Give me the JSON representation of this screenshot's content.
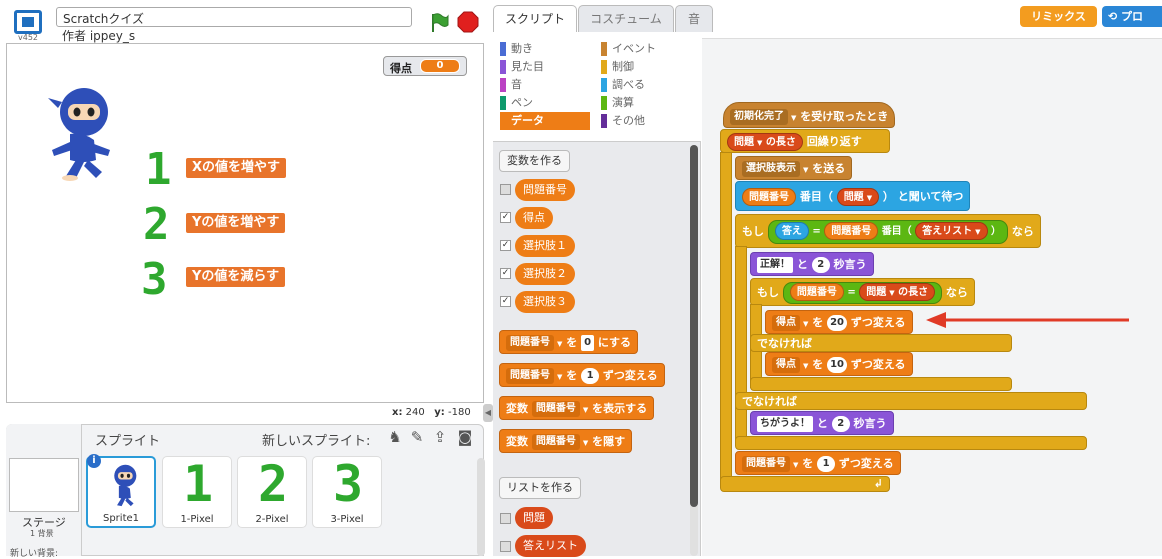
{
  "header": {
    "version": "v452",
    "project_title": "Scratchクイズ",
    "author": "作者 ippey_s"
  },
  "stage": {
    "score_label": "得点",
    "score_value": "0",
    "rows": [
      {
        "num": "1",
        "label": "Xの値を増やす"
      },
      {
        "num": "2",
        "label": "Yの値を増やす"
      },
      {
        "num": "3",
        "label": "Yの値を減らす"
      }
    ],
    "coords_x_label": "x:",
    "coords_x": "240",
    "coords_y_label": "y:",
    "coords_y": "-180"
  },
  "sprites": {
    "header": "スプライト",
    "new_sprite": "新しいスプライト:",
    "stage_name": "ステージ",
    "stage_count": "1 背景",
    "new_bg": "新しい背景:",
    "items": [
      {
        "name": "Sprite1",
        "glyph": ""
      },
      {
        "name": "1-Pixel",
        "glyph": "1"
      },
      {
        "name": "2-Pixel",
        "glyph": "2"
      },
      {
        "name": "3-Pixel",
        "glyph": "3"
      }
    ]
  },
  "tabs": [
    "スクリプト",
    "コスチューム",
    "音"
  ],
  "topbar": {
    "remix": "リミックス",
    "pro": "プロ"
  },
  "categories": {
    "left": [
      {
        "label": "動き",
        "color": "#4a6cd4"
      },
      {
        "label": "見た目",
        "color": "#8a55d7"
      },
      {
        "label": "音",
        "color": "#bb42c3"
      },
      {
        "label": "ペン",
        "color": "#0e9a6c"
      },
      {
        "label": "データ",
        "color": "#ee7d16"
      }
    ],
    "right": [
      {
        "label": "イベント",
        "color": "#c88330"
      },
      {
        "label": "制御",
        "color": "#e1a91a"
      },
      {
        "label": "調べる",
        "color": "#2ca5e2"
      },
      {
        "label": "演算",
        "color": "#5cb712"
      },
      {
        "label": "その他",
        "color": "#632d99"
      }
    ]
  },
  "palette": {
    "make_var": "変数を作る",
    "vars": [
      {
        "name": "問題番号",
        "checked": false
      },
      {
        "name": "得点",
        "checked": true
      },
      {
        "name": "選択肢１",
        "checked": true
      },
      {
        "name": "選択肢２",
        "checked": true
      },
      {
        "name": "選択肢３",
        "checked": true
      }
    ],
    "set_var": "問題番号",
    "set_to": "を",
    "set_val": "0",
    "set_end": "にする",
    "chg_var": "問題番号",
    "chg_by": "を",
    "chg_val": "1",
    "chg_end": "ずつ変える",
    "show_pre": "変数",
    "show_var": "問題番号",
    "show_end": "を表示する",
    "hide_pre": "変数",
    "hide_var": "問題番号",
    "hide_end": "を隠す",
    "make_list": "リストを作る",
    "lists": [
      {
        "name": "問題",
        "checked": false
      },
      {
        "name": "答えリスト",
        "checked": false
      }
    ]
  },
  "script": {
    "hat_dd": "初期化完了",
    "hat_text": "を受け取ったとき",
    "repeat_dd": "問題",
    "repeat_len": "の長さ",
    "repeat_end": "回繰り返す",
    "bc_dd": "選択肢表示",
    "bc_text": "を送る",
    "ask_var": "問題番号",
    "ask_mid": "番目（",
    "ask_list": "問題",
    "ask_close": "）",
    "ask_end": "と聞いて待つ",
    "if1_kw": "もし",
    "if1_ans": "答え",
    "eq": "=",
    "if1_var": "問題番号",
    "if1_mid": "番目（",
    "if1_list": "答えリスト",
    "if1_close": "）",
    "if1_end": "なら",
    "say1_txt": "正解！",
    "say1_and": "と",
    "say1_secs": "2",
    "say1_end": "秒言う",
    "if2_kw": "もし",
    "if2_var": "問題番号",
    "if2_list": "問題",
    "if2_len": "の長さ",
    "if2_end": "なら",
    "chg1_var": "得点",
    "chg1_by": "を",
    "chg1_val": "20",
    "chg1_end": "ずつ変える",
    "else1": "でなければ",
    "chg2_var": "得点",
    "chg2_by": "を",
    "chg2_val": "10",
    "chg2_end": "ずつ変える",
    "else2": "でなければ",
    "say2_txt": "ちがうよ！",
    "say2_and": "と",
    "say2_secs": "2",
    "say2_end": "秒言う",
    "chg3_var": "問題番号",
    "chg3_by": "を",
    "chg3_val": "1",
    "chg3_end": "ずつ変える"
  },
  "colors": {
    "arrow": "#e03a26",
    "accent": "#ee7d16"
  }
}
